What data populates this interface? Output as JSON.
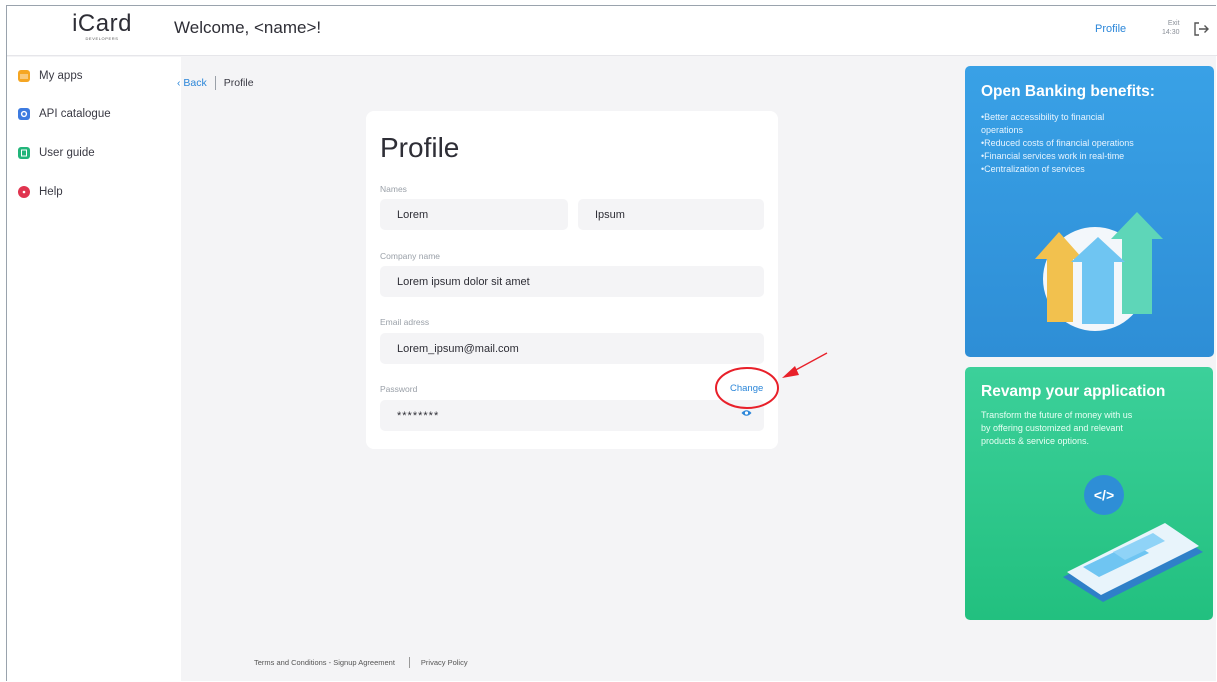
{
  "header": {
    "logo_text": "iCard",
    "logo_subtext": "DEVELOPERS",
    "welcome": "Welcome, <name>!",
    "profile_link": "Profile",
    "exit_label": "Exit",
    "exit_time": "14:30"
  },
  "sidebar": {
    "items": [
      {
        "label": "My apps",
        "icon": "folder-icon",
        "color": "#f5a623"
      },
      {
        "label": "API catalogue",
        "icon": "gear-icon",
        "color": "#3d7be0"
      },
      {
        "label": "User guide",
        "icon": "book-icon",
        "color": "#22b57a"
      },
      {
        "label": "Help",
        "icon": "help-icon",
        "color": "#e0344f"
      }
    ]
  },
  "breadcrumb": {
    "back": "‹ Back",
    "current": "Profile"
  },
  "profile": {
    "title": "Profile",
    "names_label": "Names",
    "first_name": "Lorem",
    "last_name": "Ipsum",
    "company_label": "Company name",
    "company": "Lorem ipsum dolor sit amet",
    "email_label": "Email adress",
    "email": "Lorem_ipsum@mail.com",
    "password_label": "Password",
    "password": "********",
    "change_link": "Change"
  },
  "promos": [
    {
      "title": "Open Banking benefits:",
      "lines": [
        "•Better accessibility to financial",
        "operations",
        "•Reduced costs of financial operations",
        "•Financial services work in real-time",
        "•Centralization of services"
      ],
      "color": "#2e8ed6"
    },
    {
      "title": "Revamp your application",
      "lines": [
        "Transform the future of money with us",
        "by offering customized and relevant",
        "products & service options."
      ],
      "icon_text": "</>",
      "color": "#22c07f"
    }
  ],
  "footer": {
    "terms": "Terms and Conditions - Signup Agreement",
    "privacy": "Privacy Policy"
  },
  "colors": {
    "accent": "#2b86d9",
    "annotation": "#e8202a"
  }
}
